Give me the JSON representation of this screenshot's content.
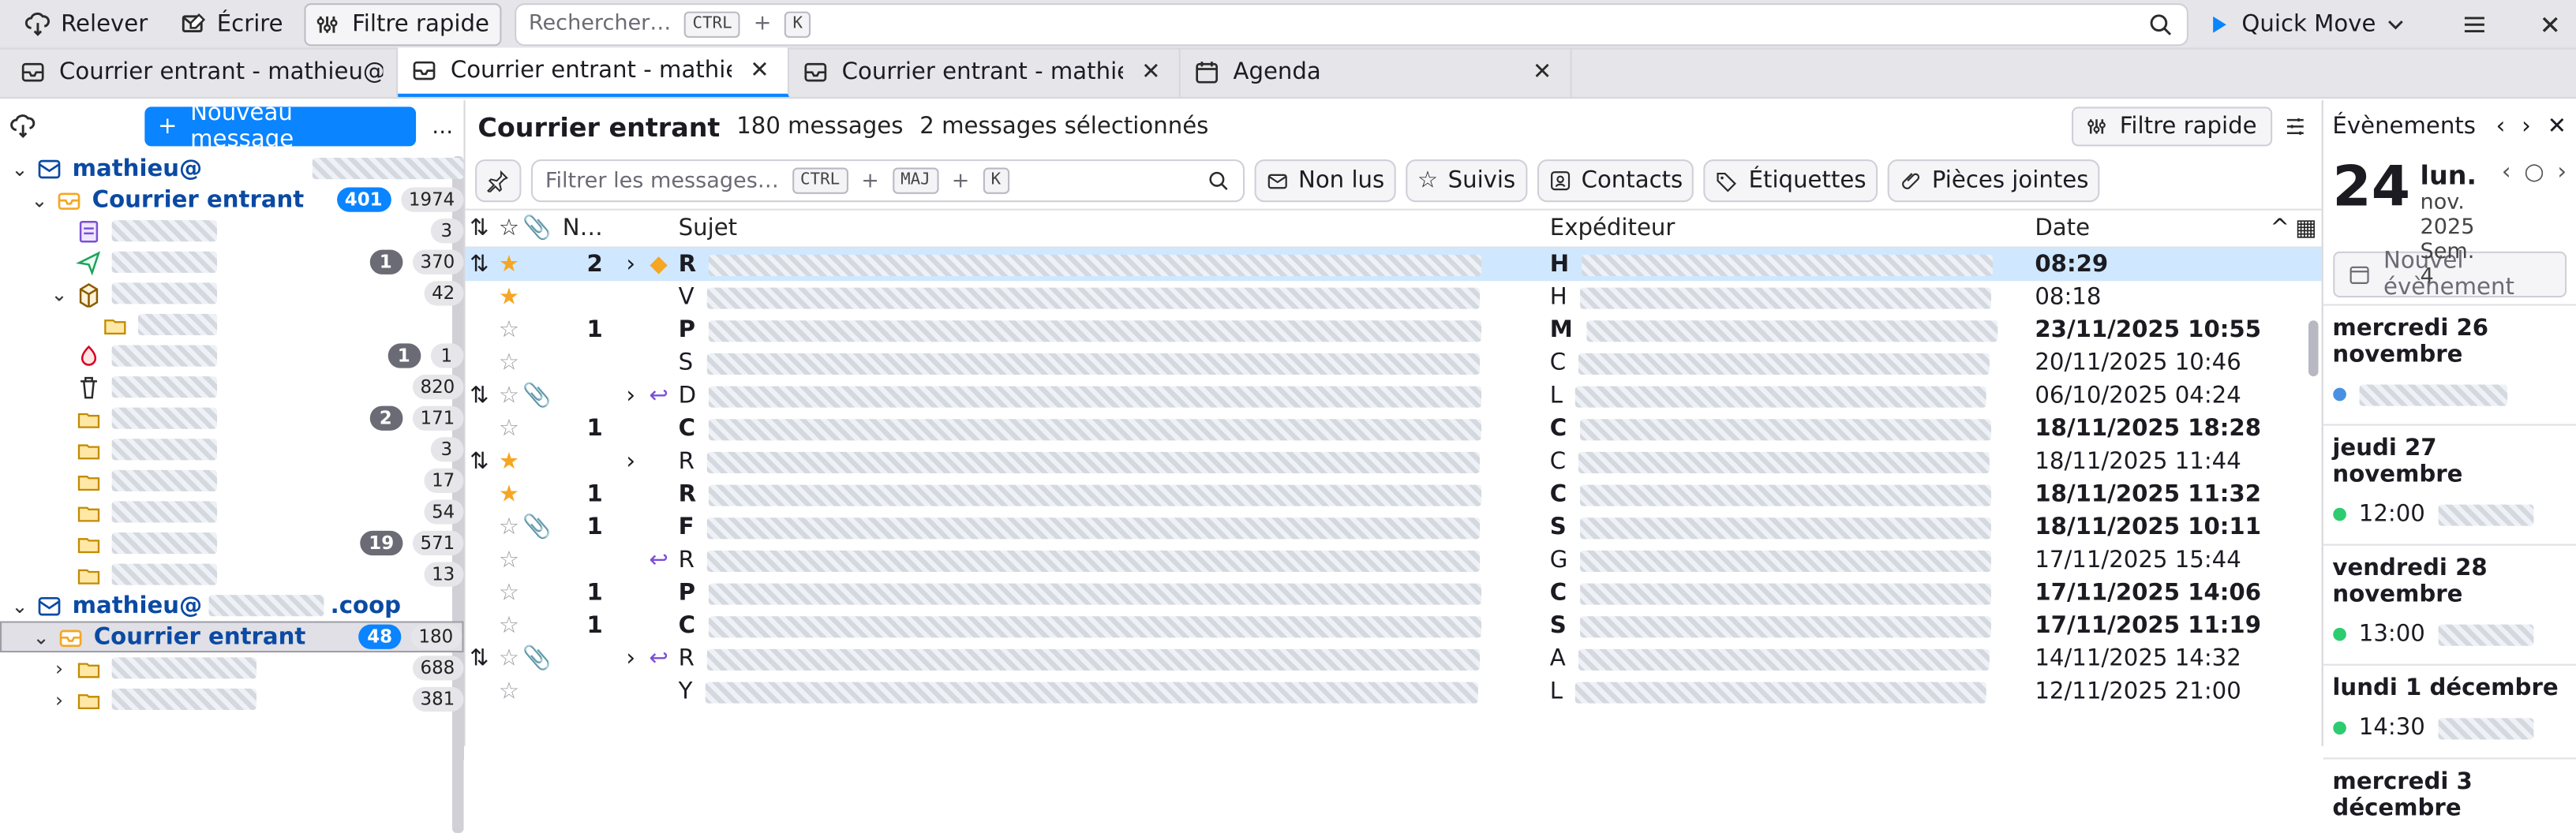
{
  "toolbar": {
    "get_messages": "Relever",
    "write": "Écrire",
    "quick_filter": "Filtre rapide",
    "search_placeholder": "Rechercher…",
    "search_shortcut_1": "CTRL",
    "search_shortcut_plus": "+",
    "search_shortcut_2": "K",
    "quick_move": "Quick Move"
  },
  "tabs": [
    {
      "title": "Courrier entrant - mathieu@bid"
    },
    {
      "title": "Courrier entrant - mathieu@"
    },
    {
      "title": "Courrier entrant - mathieu@"
    },
    {
      "title": "Agenda"
    }
  ],
  "folder_pane": {
    "new_message": "Nouveau message",
    "more": "…",
    "account1": "mathieu@",
    "account1_inbox": {
      "name": "Courrier entrant",
      "unread": "401",
      "total": "1974"
    },
    "folders1": [
      {
        "unread": "",
        "total": "3"
      },
      {
        "unread": "1",
        "total": "370"
      },
      {
        "unread": "",
        "total": "42"
      },
      {
        "unread": "",
        "total": ""
      },
      {
        "unread": "1",
        "total": "1"
      },
      {
        "unread": "",
        "total": "820"
      },
      {
        "unread": "2",
        "total": "171"
      },
      {
        "unread": "",
        "total": "3"
      },
      {
        "unread": "",
        "total": "17"
      },
      {
        "unread": "",
        "total": "54"
      },
      {
        "unread": "19",
        "total": "571"
      },
      {
        "unread": "",
        "total": "13"
      }
    ],
    "account2": "mathieu@",
    "account2_suffix": ".coop",
    "account2_inbox": {
      "name": "Courrier entrant",
      "unread": "48",
      "total": "180"
    },
    "folders2": [
      {
        "unread": "",
        "total": "688"
      },
      {
        "unread": "",
        "total": "381"
      }
    ]
  },
  "message_pane": {
    "title": "Courrier entrant",
    "count": "180 messages",
    "selected": "2 messages sélectionnés",
    "quick_filter": "Filtre rapide",
    "filter_placeholder": "Filtrer les messages…",
    "filter_shortcut_1": "CTRL",
    "filter_shortcut_plus1": "+",
    "filter_shortcut_2": "MAJ",
    "filter_shortcut_plus2": "+",
    "filter_shortcut_3": "K",
    "filters": [
      "Non lus",
      "Suivis",
      "Contacts",
      "Étiquettes",
      "Pièces jointes"
    ],
    "columns": {
      "n": "N…",
      "subject": "Sujet",
      "from": "Expéditeur",
      "date": "Date"
    },
    "rows": [
      {
        "n": "2",
        "subject": "R",
        "from": "H",
        "date": "08:29",
        "selected": true,
        "bold": true,
        "star": true,
        "thread": true,
        "arrow": ">",
        "dot": true
      },
      {
        "n": "",
        "subject": "V",
        "from": "H",
        "date": "08:18",
        "selected": false,
        "bold": false,
        "star": true
      },
      {
        "n": "1",
        "subject": "P",
        "from": "M",
        "date": "23/11/2025 10:55",
        "selected": false,
        "bold": true
      },
      {
        "n": "",
        "subject": "S",
        "from": "C",
        "date": "20/11/2025 10:46",
        "selected": false,
        "bold": false
      },
      {
        "n": "",
        "subject": "D",
        "from": "L",
        "date": "06/10/2025 04:24",
        "selected": false,
        "bold": false,
        "thread": true,
        "attach": true,
        "arrow": ">",
        "reply": "↩"
      },
      {
        "n": "1",
        "subject": "C",
        "from": "C",
        "date": "18/11/2025 18:28",
        "selected": false,
        "bold": true
      },
      {
        "n": "",
        "subject": "R",
        "from": "C",
        "date": "18/11/2025 11:44",
        "selected": false,
        "bold": false,
        "thread": true,
        "star": true,
        "arrow": ">"
      },
      {
        "n": "1",
        "subject": "R",
        "from": "C",
        "date": "18/11/2025 11:32",
        "selected": false,
        "bold": true,
        "star": true
      },
      {
        "n": "1",
        "subject": "F",
        "from": "S",
        "date": "18/11/2025 10:11",
        "selected": false,
        "bold": true,
        "attach": true
      },
      {
        "n": "",
        "subject": "R",
        "from": "G",
        "date": "17/11/2025 15:44",
        "selected": false,
        "bold": false,
        "reply": "↩"
      },
      {
        "n": "1",
        "subject": "P",
        "from": "C",
        "date": "17/11/2025 14:06",
        "selected": false,
        "bold": true
      },
      {
        "n": "1",
        "subject": "C",
        "from": "S",
        "date": "17/11/2025 11:19",
        "selected": false,
        "bold": true
      },
      {
        "n": "",
        "subject": "R",
        "from": "A",
        "date": "14/11/2025 14:32",
        "selected": false,
        "bold": false,
        "thread": true,
        "attach": true,
        "arrow": ">",
        "reply": "↩"
      },
      {
        "n": "",
        "subject": "Y",
        "from": "L",
        "date": "12/11/2025 21:00",
        "selected": false,
        "bold": false
      }
    ]
  },
  "events_pane": {
    "title": "Évènements",
    "day_number": "24",
    "day_name": "lun.",
    "month_line": "nov. 2025",
    "week": "Sem. 4",
    "new_event": "Nouvel évènement",
    "sections": [
      {
        "title": "mercredi 26 novembre",
        "items": [
          {
            "time": "",
            "color": "#4a90e2"
          }
        ]
      },
      {
        "title": "jeudi 27 novembre",
        "items": [
          {
            "time": "12:00",
            "color": "#2ecc71"
          }
        ]
      },
      {
        "title": "vendredi 28 novembre",
        "items": [
          {
            "time": "13:00",
            "color": "#2ecc71"
          }
        ]
      },
      {
        "title": "lundi 1 décembre",
        "items": [
          {
            "time": "14:30",
            "color": "#2ecc71"
          }
        ]
      },
      {
        "title": "mercredi 3 décembre",
        "items": []
      }
    ]
  },
  "colors": {
    "accent": "#0a84ff",
    "selected_row": "#cfe8ff",
    "star": "#f6a623"
  }
}
